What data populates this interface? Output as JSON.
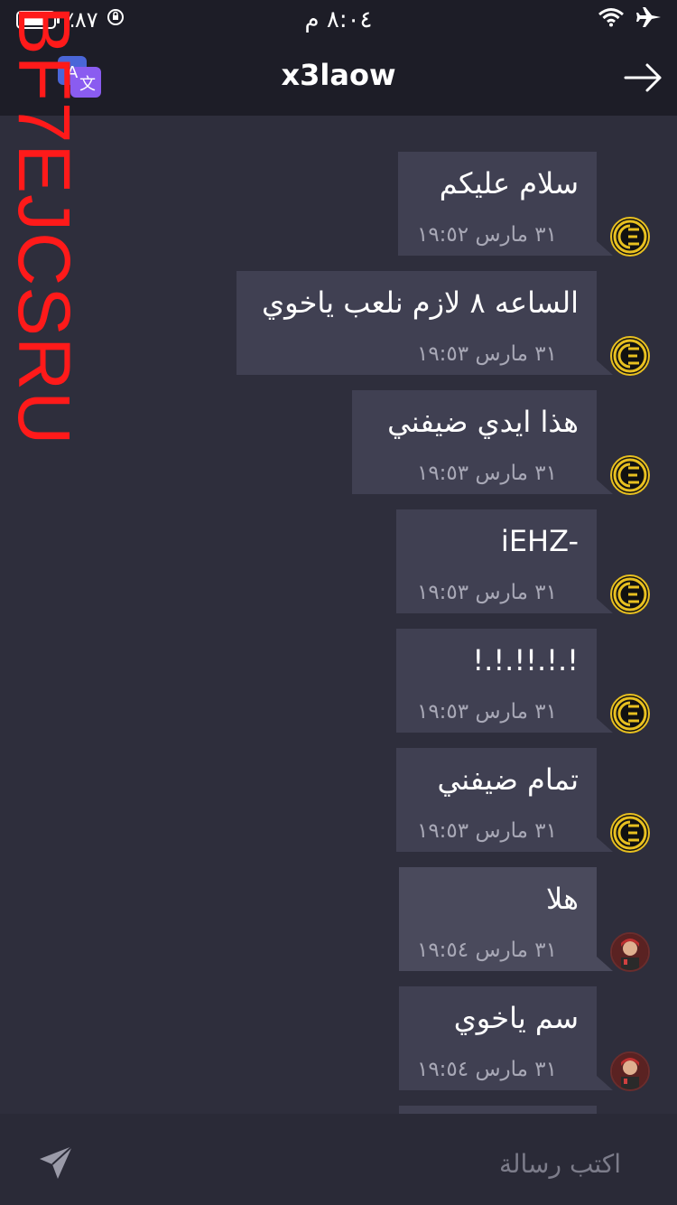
{
  "status_bar": {
    "battery_percent": "٪٨٧",
    "battery_level": 0.87,
    "time": "٨:٠٤ م"
  },
  "header": {
    "title": "x3laow"
  },
  "messages": [
    {
      "text": "سلام عليكم",
      "time": "٣١ مارس ١٩:٥٢",
      "avatar": "gold-logo"
    },
    {
      "text": "الساعه ٨ لازم نلعب ياخوي",
      "time": "٣١ مارس ١٩:٥٣",
      "avatar": "gold-logo"
    },
    {
      "text": "هذا ايدي ضيفني",
      "time": "٣١ مارس ١٩:٥٣",
      "avatar": "gold-logo"
    },
    {
      "text": "iEHZ-",
      "time": "٣١ مارس ١٩:٥٣",
      "avatar": "gold-logo"
    },
    {
      "text": "!.!.!!.!.!",
      "time": "٣١ مارس ١٩:٥٣",
      "avatar": "gold-logo"
    },
    {
      "text": "تمام ضيفني",
      "time": "٣١ مارس ١٩:٥٣",
      "avatar": "gold-logo"
    },
    {
      "text": "هلا",
      "time": "٣١ مارس ١٩:٥٤",
      "avatar": "game-character"
    },
    {
      "text": "سم ياخوي",
      "time": "٣١ مارس ١٩:٥٤",
      "avatar": "game-character"
    }
  ],
  "composer": {
    "placeholder": "اكتب رسالة"
  },
  "watermark": {
    "text": "BF7EJCSRU"
  },
  "icons": {
    "translate": "translate-icon",
    "back": "arrow-right-icon",
    "send": "send-icon",
    "wifi": "wifi-icon",
    "airplane": "airplane-icon",
    "rotation_lock": "rotation-lock-icon"
  },
  "colors": {
    "background": "#2e2e3c",
    "header": "#1d1d27",
    "bubble": "#404052",
    "timestamp": "#a8a8b6",
    "watermark": "#ff1a1a",
    "translate_accent": "#7a5cf0"
  }
}
